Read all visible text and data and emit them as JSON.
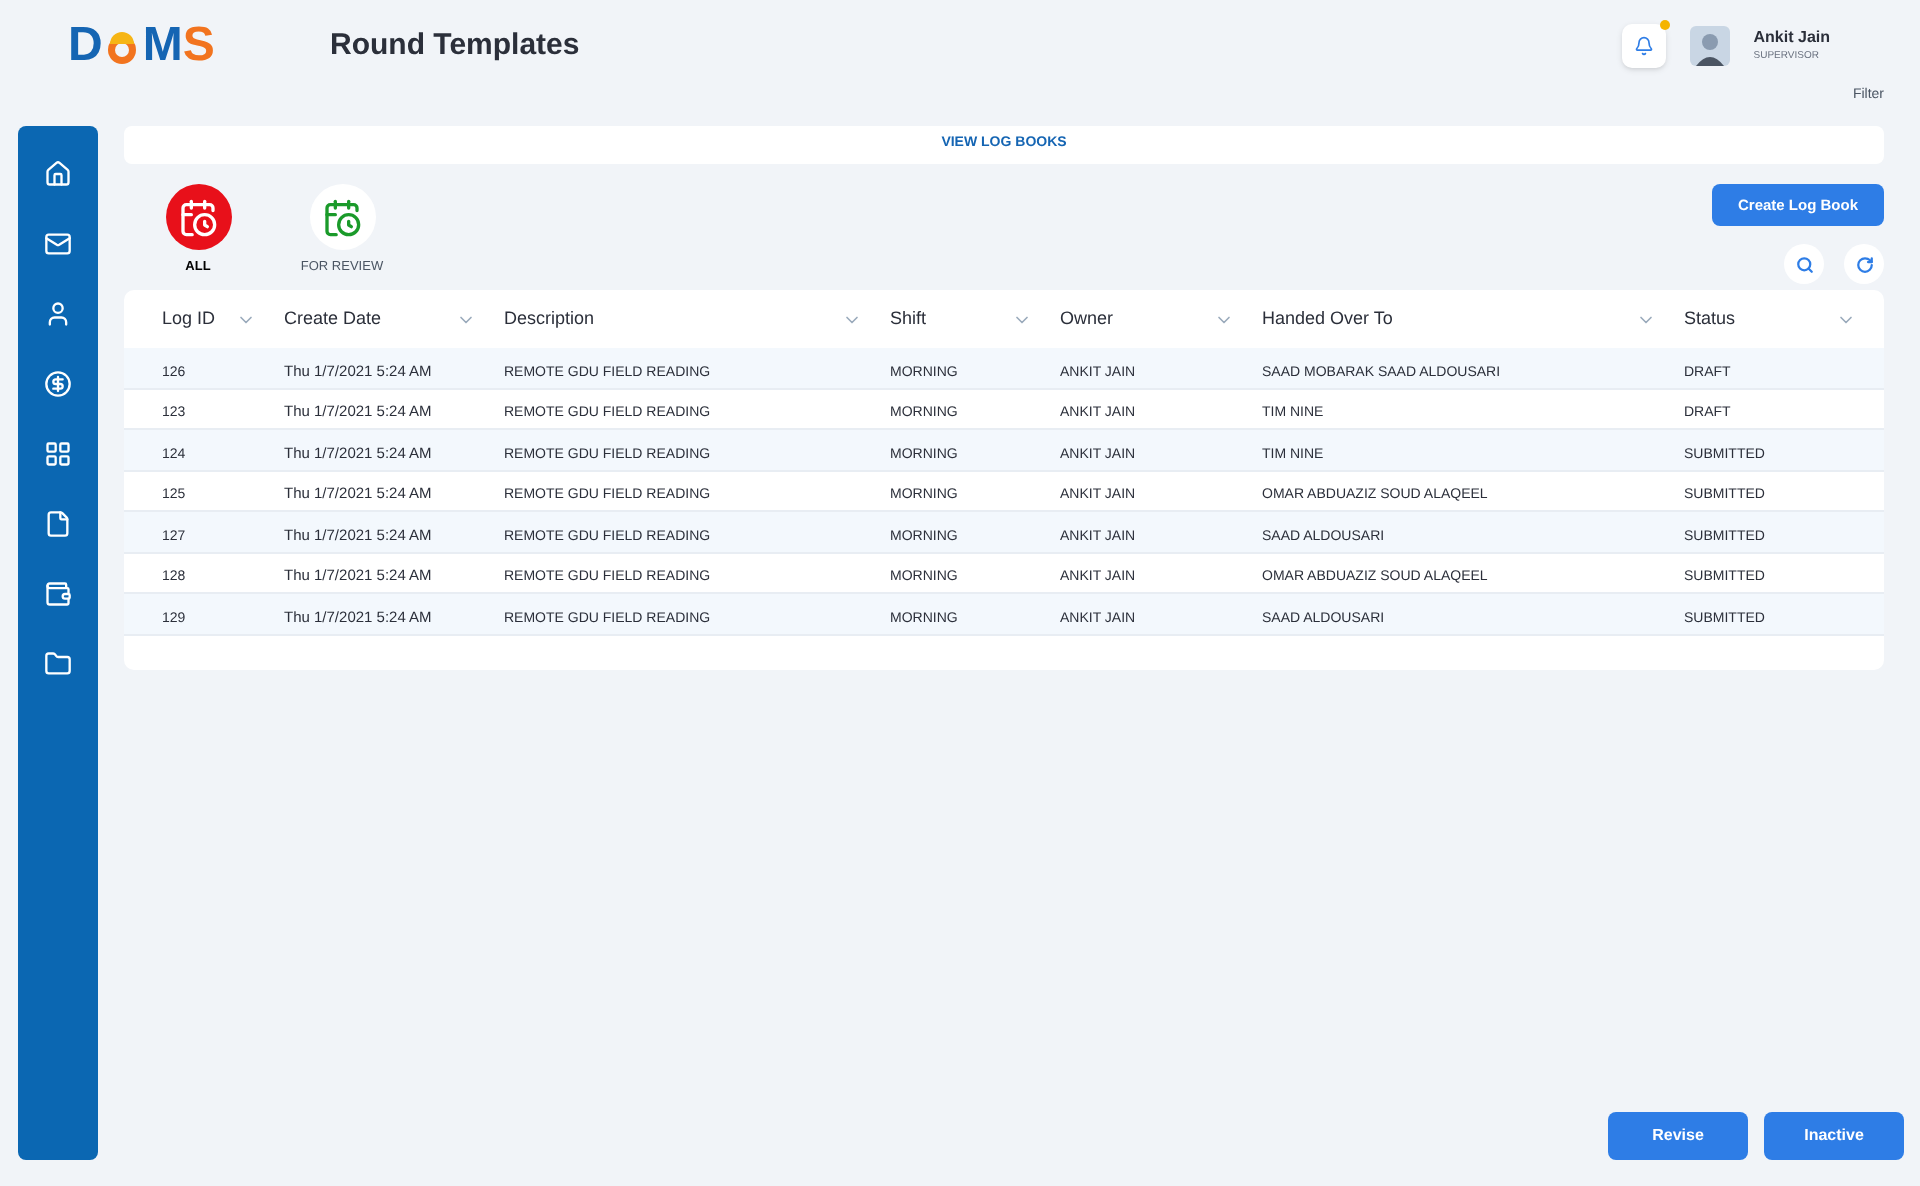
{
  "logo": {
    "left": "D",
    "right": "MS"
  },
  "page_title": "Round Templates",
  "notifications": {
    "unread": true
  },
  "user": {
    "name": "Ankit Jain",
    "role": "SUPERVISOR"
  },
  "filter_link": "Filter",
  "view_bar": "VIEW LOG BOOKS",
  "filters": [
    {
      "label": "ALL",
      "selected": true
    },
    {
      "label": "FOR REVIEW",
      "selected": false
    }
  ],
  "create_button": "Create Log Book",
  "table": {
    "columns": [
      "Log ID",
      "Create Date",
      "Description",
      "Shift",
      "Owner",
      "Handed Over To",
      "Status"
    ],
    "rows": [
      [
        "126",
        "Thu 1/7/2021 5:24 AM",
        "REMOTE GDU FIELD READING",
        "MORNING",
        "ANKIT JAIN",
        "SAAD MOBARAK SAAD ALDOUSARI",
        "DRAFT"
      ],
      [
        "123",
        "Thu 1/7/2021 5:24 AM",
        "REMOTE GDU FIELD READING",
        "MORNING",
        "ANKIT JAIN",
        "TIM NINE",
        "DRAFT"
      ],
      [
        "124",
        "Thu 1/7/2021 5:24 AM",
        "REMOTE GDU FIELD READING",
        "MORNING",
        "ANKIT JAIN",
        "TIM NINE",
        "SUBMITTED"
      ],
      [
        "125",
        "Thu 1/7/2021 5:24 AM",
        "REMOTE GDU FIELD READING",
        "MORNING",
        "ANKIT JAIN",
        "OMAR ABDUAZIZ SOUD ALAQEEL",
        "SUBMITTED"
      ],
      [
        "127",
        "Thu 1/7/2021 5:24 AM",
        "REMOTE GDU FIELD READING",
        "MORNING",
        "ANKIT JAIN",
        "SAAD ALDOUSARI",
        "SUBMITTED"
      ],
      [
        "128",
        "Thu 1/7/2021 5:24 AM",
        "REMOTE GDU FIELD READING",
        "MORNING",
        "ANKIT JAIN",
        "OMAR ABDUAZIZ SOUD ALAQEEL",
        "SUBMITTED"
      ],
      [
        "129",
        "Thu 1/7/2021 5:24 AM",
        "REMOTE GDU FIELD READING",
        "MORNING",
        "ANKIT JAIN",
        "SAAD ALDOUSARI",
        "SUBMITTED"
      ]
    ]
  },
  "footer_buttons": [
    "Revise",
    "Inactive"
  ]
}
